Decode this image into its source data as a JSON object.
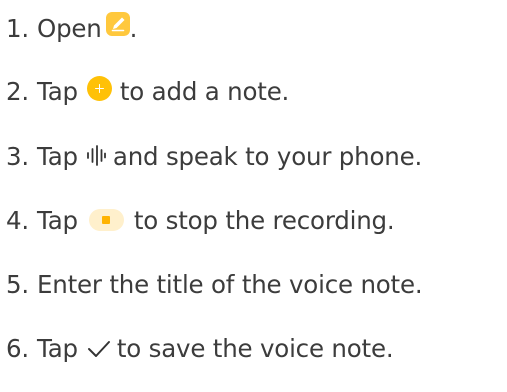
{
  "steps": [
    {
      "number": "1.",
      "before": "Open",
      "icon": "notes-app-icon",
      "after": "."
    },
    {
      "number": "2.",
      "before": "Tap",
      "icon": "add-icon",
      "after": "to add a note."
    },
    {
      "number": "3.",
      "before": "Tap",
      "icon": "voice-waveform-icon",
      "after": "and speak to your phone."
    },
    {
      "number": "4.",
      "before": "Tap",
      "icon": "stop-icon",
      "after": "to stop the recording."
    },
    {
      "number": "5.",
      "text": "Enter the title of the voice note."
    },
    {
      "number": "6.",
      "before": "Tap",
      "icon": "check-icon",
      "after": "to save the voice note."
    }
  ],
  "colors": {
    "text": "#3c3c3c",
    "accent": "#ffc107",
    "accent_light": "#fff0cc"
  }
}
